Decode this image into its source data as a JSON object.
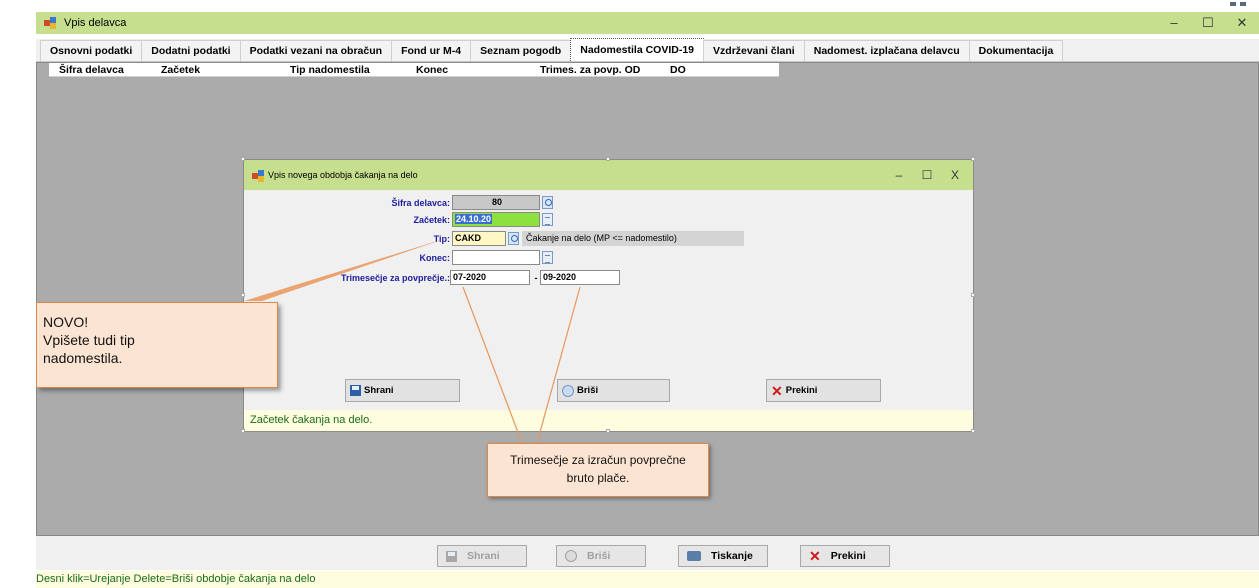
{
  "main_window": {
    "title": "Vpis delavca",
    "controls": {
      "minimize": "–",
      "maximize": "☐",
      "close": "✕"
    },
    "tabs": [
      {
        "label": "Osnovni podatki",
        "active": false
      },
      {
        "label": "Dodatni podatki",
        "active": false
      },
      {
        "label": "Podatki vezani na obračun",
        "active": false
      },
      {
        "label": "Fond ur M-4",
        "active": false
      },
      {
        "label": "Seznam pogodb",
        "active": false
      },
      {
        "label": "Nadomestila COVID-19",
        "active": true
      },
      {
        "label": "Vzdrževani člani",
        "active": false
      },
      {
        "label": "Nadomest. izplačana delavcu",
        "active": false
      },
      {
        "label": "Dokumentacija",
        "active": false
      }
    ],
    "grid_columns": [
      "Šifra delavca",
      "Začetek",
      "Tip nadomestila",
      "Konec",
      "Trimes. za povp. OD",
      "DO"
    ],
    "footer_buttons": {
      "save": "Shrani",
      "delete": "Briši",
      "print": "Tiskanje",
      "cancel": "Prekini"
    },
    "status_text": "Desni klik=Urejanje Delete=Briši obdobje čakanja na delo"
  },
  "dialog": {
    "title": "Vpis novega obdobja čakanja na delo",
    "controls": {
      "minimize": "–",
      "maximize": "☐",
      "close": "X"
    },
    "fields": {
      "employee_id_label": "Šifra delavca:",
      "employee_id_value": "80",
      "start_label": "Začetek:",
      "start_value": "24.10.20",
      "type_label": "Tip:",
      "type_value": "CAKD",
      "type_description": "Čakanje na delo (MP <= nadomestilo)",
      "end_label": "Konec:",
      "end_value": "",
      "quarter_label": "Trimesečje za povprečje.:",
      "quarter_from": "07-2020",
      "quarter_separator": "-",
      "quarter_to": "09-2020"
    },
    "buttons": {
      "save": "Shrani",
      "delete": "Briši",
      "cancel": "Prekini"
    },
    "status_text": "Začetek čakanja na delo."
  },
  "callouts": {
    "new_type": [
      "NOVO!",
      "Vpišete tudi tip",
      "nadomestila."
    ],
    "quarter": [
      "Trimesečje za izračun povprečne",
      "bruto plače."
    ]
  },
  "colors": {
    "titlebar": "#c5df8f",
    "status_bg": "#fffde0",
    "status_text": "#1a6a1a",
    "field_label": "#1c1c9c",
    "highlight_field": "#8ce13c",
    "callout_bg": "#fce4d2",
    "callout_border": "#d98b4f"
  }
}
